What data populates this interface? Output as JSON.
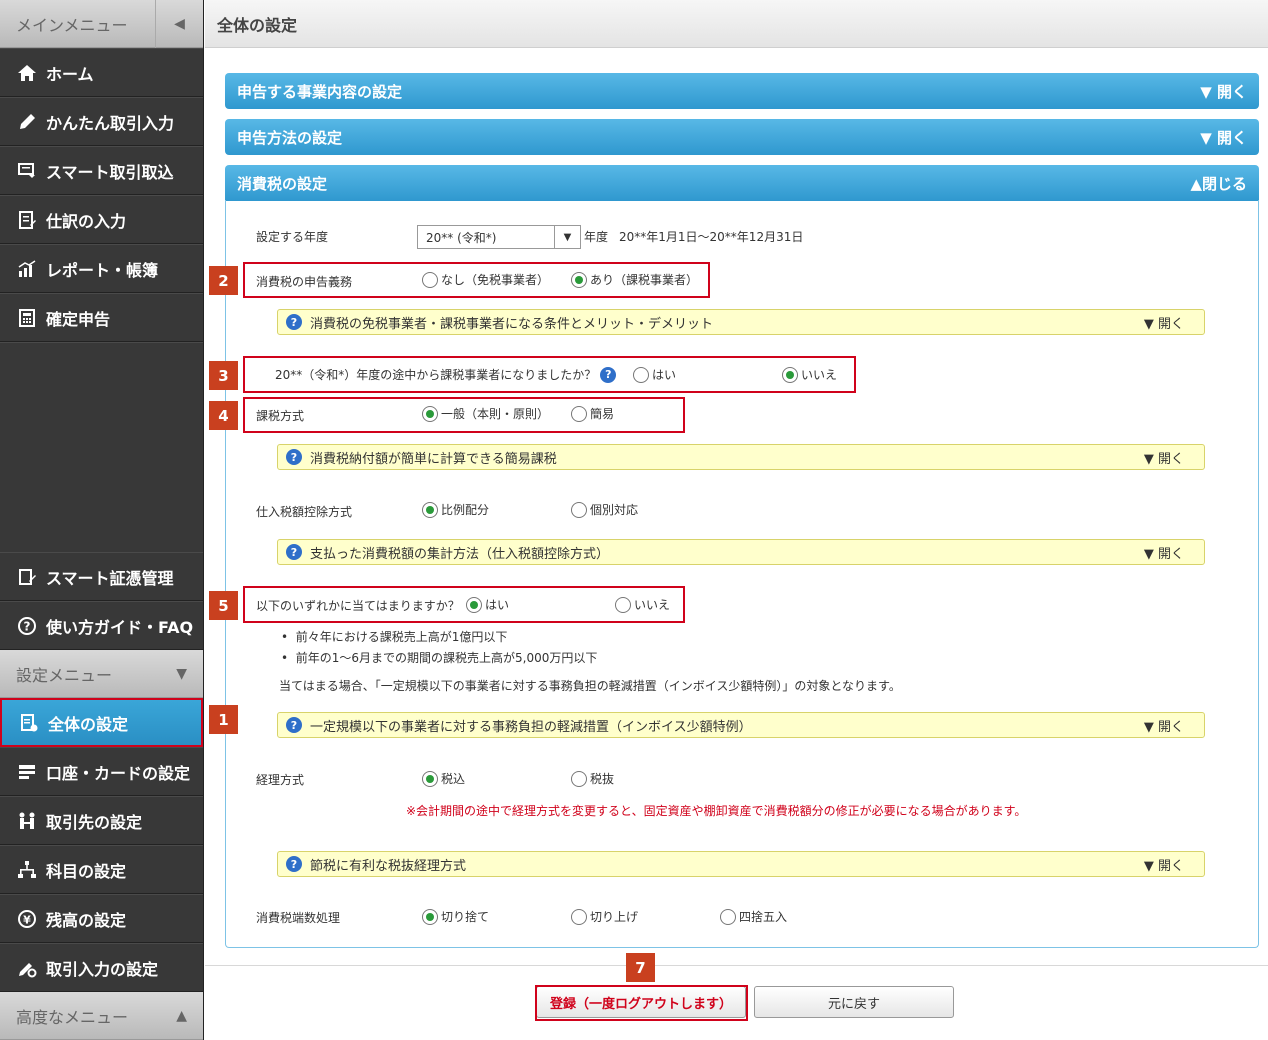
{
  "sidebar": {
    "main_menu_label": "メインメニュー",
    "main_items": [
      {
        "label": "ホーム",
        "icon": "home-icon"
      },
      {
        "label": "かんたん取引入力",
        "icon": "pencil-icon"
      },
      {
        "label": "スマート取引取込",
        "icon": "import-icon"
      },
      {
        "label": "仕訳の入力",
        "icon": "journal-icon"
      },
      {
        "label": "レポート・帳簿",
        "icon": "report-icon"
      },
      {
        "label": "確定申告",
        "icon": "calculator-icon"
      }
    ],
    "extra_items": [
      {
        "label": "スマート証憑管理",
        "icon": "receipt-icon"
      },
      {
        "label": "使い方ガイド・FAQ",
        "icon": "help-icon"
      }
    ],
    "settings_menu_label": "設定メニュー",
    "settings_items": [
      {
        "label": "全体の設定",
        "icon": "settings-doc-icon"
      },
      {
        "label": "口座・カードの設定",
        "icon": "card-icon"
      },
      {
        "label": "取引先の設定",
        "icon": "partner-icon"
      },
      {
        "label": "科目の設定",
        "icon": "tree-icon"
      },
      {
        "label": "残高の設定",
        "icon": "yen-icon"
      },
      {
        "label": "取引入力の設定",
        "icon": "gear-pencil-icon"
      }
    ],
    "advanced_menu_label": "高度なメニュー"
  },
  "header": {
    "title": "全体の設定"
  },
  "accordions": [
    {
      "label": "申告する事業内容の設定",
      "toggle": "▼ 開く"
    },
    {
      "label": "申告方法の設定",
      "toggle": "▼ 開く"
    },
    {
      "label": "消費税の設定",
      "toggle": "▲閉じる"
    }
  ],
  "form": {
    "year_label": "設定する年度",
    "year_value": "20** (令和*)",
    "year_suffix": "年度",
    "year_range": "20**年1月1日～20**年12月31日",
    "duty_label": "消費税の申告義務",
    "duty_opt1": "なし（免税事業者）",
    "duty_opt2": "あり（課税事業者）",
    "info1": "消費税の免税事業者・課税事業者になる条件とメリット・デメリット",
    "midyear_question": "20**（令和*）年度の途中から課税事業者になりましたか？",
    "midyear_yes": "はい",
    "midyear_no": "いいえ",
    "method_label": "課税方式",
    "method_opt1": "一般（本則・原則）",
    "method_opt2": "簡易",
    "info2": "消費税納付額が簡単に計算できる簡易課税",
    "deduction_label": "仕入税額控除方式",
    "deduction_opt1": "比例配分",
    "deduction_opt2": "個別対応",
    "info3": "支払った消費税額の集計方法（仕入税額控除方式）",
    "applies_question": "以下のいずれかに当てはまりますか？",
    "applies_yes": "はい",
    "applies_no": "いいえ",
    "bullet1": "前々年における課税売上高が1億円以下",
    "bullet2": "前年の1～6月までの期間の課税売上高が5,000万円以下",
    "applies_note": "当てはまる場合、「一定規模以下の事業者に対する事務負担の軽減措置（インボイス少額特例）」の対象となります。",
    "info4": "一定規模以下の事業者に対する事務負担の軽減措置（インボイス少額特例）",
    "accounting_label": "経理方式",
    "accounting_opt1": "税込",
    "accounting_opt2": "税抜",
    "accounting_warning": "※会計期間の途中で経理方式を変更すると、固定資産や棚卸資産で消費税額分の修正が必要になる場合があります。",
    "info5": "節税に有利な税抜経理方式",
    "rounding_label": "消費税端数処理",
    "rounding_opt1": "切り捨て",
    "rounding_opt2": "切り上げ",
    "rounding_opt3": "四捨五入",
    "info_open": "▼ 開く"
  },
  "badges": [
    "1",
    "2",
    "3",
    "4",
    "5",
    "7"
  ],
  "buttons": {
    "register": "登録（一度ログアウトします）",
    "reset": "元に戻す"
  },
  "colors": {
    "accent_blue": "#2f98cf",
    "highlight_red": "#d0021b",
    "badge": "#c9401f",
    "info_yellow": "#ffffcc",
    "radio_on": "#2a9a3a"
  }
}
